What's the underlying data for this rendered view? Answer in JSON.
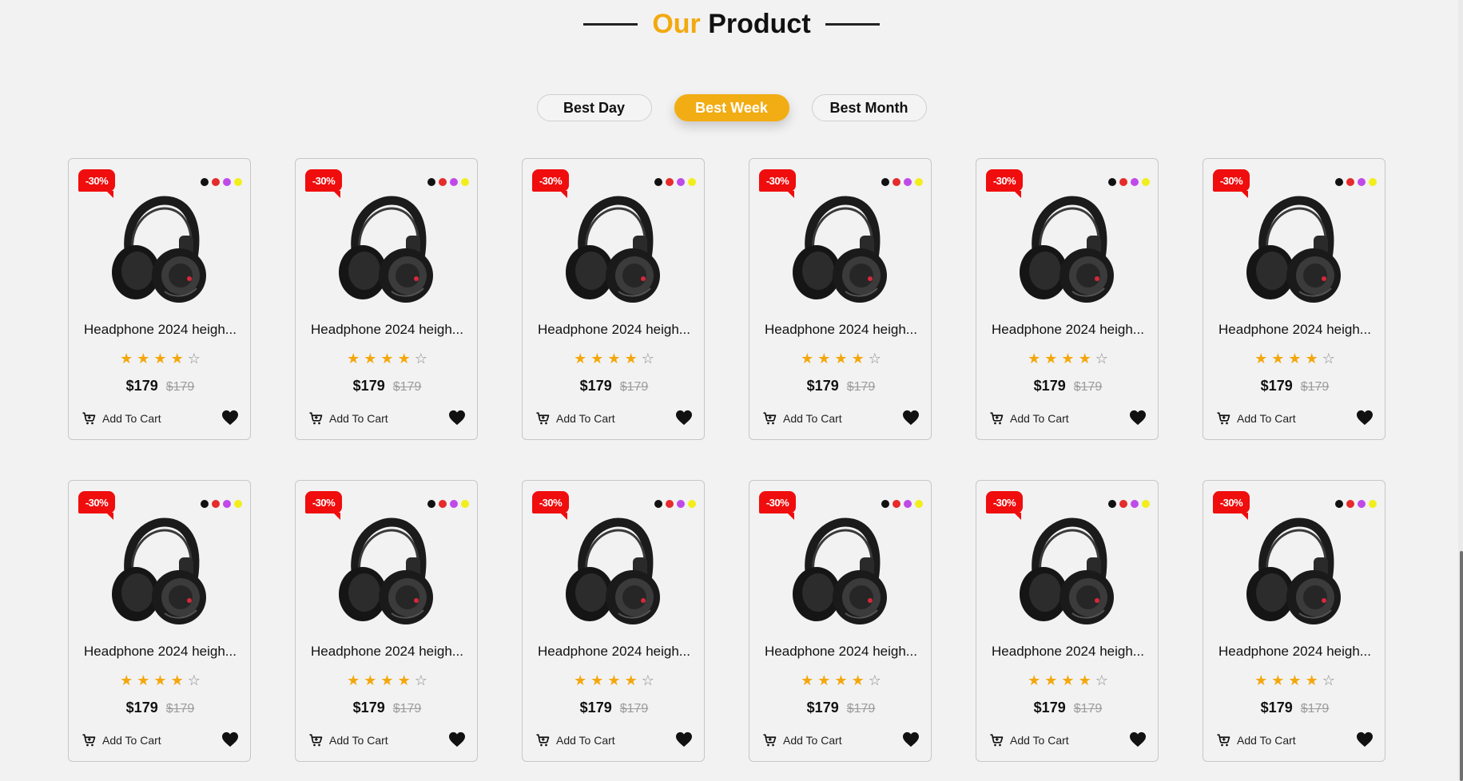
{
  "heading": {
    "accent": "Our",
    "title": "Product"
  },
  "tabs": [
    {
      "label": "Best Day",
      "active": false
    },
    {
      "label": "Best Week",
      "active": true
    },
    {
      "label": "Best Month",
      "active": false
    }
  ],
  "colors": {
    "accent": "#f2ad14",
    "badge": "#f00d0d",
    "star": "#f4a70c"
  },
  "products": [
    {
      "badge": "-30%",
      "name": "Headphone 2024 heigh...",
      "rating": 4,
      "rating_max": 5,
      "price": "$179",
      "old_price": "$179",
      "cart_label": "Add To Cart",
      "swatches": [
        "#111111",
        "#e52b2b",
        "#c04ae8",
        "#f2ee1c"
      ],
      "icons": [
        "cart-icon",
        "heart-icon"
      ]
    },
    {
      "badge": "-30%",
      "name": "Headphone 2024 heigh...",
      "rating": 4,
      "rating_max": 5,
      "price": "$179",
      "old_price": "$179",
      "cart_label": "Add To Cart",
      "swatches": [
        "#111111",
        "#e52b2b",
        "#c04ae8",
        "#f2ee1c"
      ],
      "icons": [
        "cart-icon",
        "heart-icon"
      ]
    },
    {
      "badge": "-30%",
      "name": "Headphone 2024 heigh...",
      "rating": 4,
      "rating_max": 5,
      "price": "$179",
      "old_price": "$179",
      "cart_label": "Add To Cart",
      "swatches": [
        "#111111",
        "#e52b2b",
        "#c04ae8",
        "#f2ee1c"
      ],
      "icons": [
        "cart-icon",
        "heart-icon"
      ]
    },
    {
      "badge": "-30%",
      "name": "Headphone 2024 heigh...",
      "rating": 4,
      "rating_max": 5,
      "price": "$179",
      "old_price": "$179",
      "cart_label": "Add To Cart",
      "swatches": [
        "#111111",
        "#e52b2b",
        "#c04ae8",
        "#f2ee1c"
      ],
      "icons": [
        "cart-icon",
        "heart-icon"
      ]
    },
    {
      "badge": "-30%",
      "name": "Headphone 2024 heigh...",
      "rating": 4,
      "rating_max": 5,
      "price": "$179",
      "old_price": "$179",
      "cart_label": "Add To Cart",
      "swatches": [
        "#111111",
        "#e52b2b",
        "#c04ae8",
        "#f2ee1c"
      ],
      "icons": [
        "cart-icon",
        "heart-icon"
      ]
    },
    {
      "badge": "-30%",
      "name": "Headphone 2024 heigh...",
      "rating": 4,
      "rating_max": 5,
      "price": "$179",
      "old_price": "$179",
      "cart_label": "Add To Cart",
      "swatches": [
        "#111111",
        "#e52b2b",
        "#c04ae8",
        "#f2ee1c"
      ],
      "icons": [
        "cart-icon",
        "heart-icon"
      ]
    },
    {
      "badge": "-30%",
      "name": "Headphone 2024 heigh...",
      "rating": 4,
      "rating_max": 5,
      "price": "$179",
      "old_price": "$179",
      "cart_label": "Add To Cart",
      "swatches": [
        "#111111",
        "#e52b2b",
        "#c04ae8",
        "#f2ee1c"
      ],
      "icons": [
        "cart-icon",
        "heart-icon"
      ]
    },
    {
      "badge": "-30%",
      "name": "Headphone 2024 heigh...",
      "rating": 4,
      "rating_max": 5,
      "price": "$179",
      "old_price": "$179",
      "cart_label": "Add To Cart",
      "swatches": [
        "#111111",
        "#e52b2b",
        "#c04ae8",
        "#f2ee1c"
      ],
      "icons": [
        "cart-icon",
        "heart-icon"
      ]
    },
    {
      "badge": "-30%",
      "name": "Headphone 2024 heigh...",
      "rating": 4,
      "rating_max": 5,
      "price": "$179",
      "old_price": "$179",
      "cart_label": "Add To Cart",
      "swatches": [
        "#111111",
        "#e52b2b",
        "#c04ae8",
        "#f2ee1c"
      ],
      "icons": [
        "cart-icon",
        "heart-icon"
      ]
    },
    {
      "badge": "-30%",
      "name": "Headphone 2024 heigh...",
      "rating": 4,
      "rating_max": 5,
      "price": "$179",
      "old_price": "$179",
      "cart_label": "Add To Cart",
      "swatches": [
        "#111111",
        "#e52b2b",
        "#c04ae8",
        "#f2ee1c"
      ],
      "icons": [
        "cart-icon",
        "heart-icon"
      ]
    },
    {
      "badge": "-30%",
      "name": "Headphone 2024 heigh...",
      "rating": 4,
      "rating_max": 5,
      "price": "$179",
      "old_price": "$179",
      "cart_label": "Add To Cart",
      "swatches": [
        "#111111",
        "#e52b2b",
        "#c04ae8",
        "#f2ee1c"
      ],
      "icons": [
        "cart-icon",
        "heart-icon"
      ]
    },
    {
      "badge": "-30%",
      "name": "Headphone 2024 heigh...",
      "rating": 4,
      "rating_max": 5,
      "price": "$179",
      "old_price": "$179",
      "cart_label": "Add To Cart",
      "swatches": [
        "#111111",
        "#e52b2b",
        "#c04ae8",
        "#f2ee1c"
      ],
      "icons": [
        "cart-icon",
        "heart-icon"
      ]
    }
  ]
}
